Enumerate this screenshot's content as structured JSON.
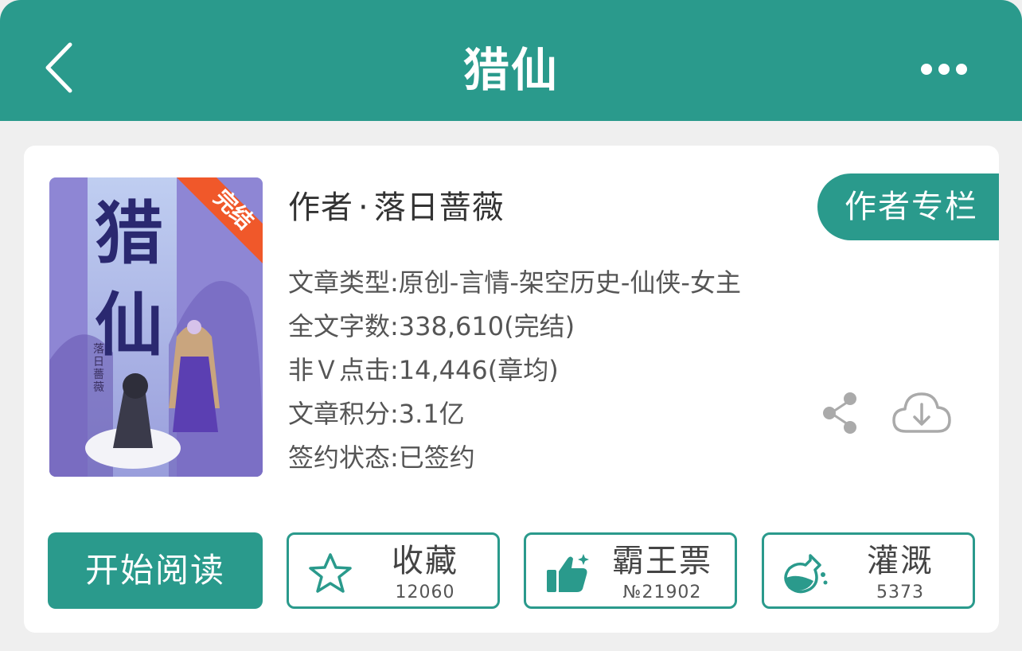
{
  "header": {
    "title": "猎仙"
  },
  "book": {
    "cover_title": "猎仙",
    "cover_badge": "完结",
    "cover_signature": "落日薔薇",
    "author_prefix": "作者",
    "author_sep": "·",
    "author_name": "落日蔷薇",
    "author_column_label": "作者专栏"
  },
  "info": {
    "genre": "文章类型:原创-言情-架空历史-仙侠-女主",
    "word_count": "全文字数:338,610(完结)",
    "clicks": "非Ｖ点击:14,446(章均)",
    "score": "文章积分:3.1亿",
    "contract": "签约状态:已签约"
  },
  "actions": {
    "read_label": "开始阅读",
    "favorite": {
      "label": "收藏",
      "count": "12060"
    },
    "tyrant_ticket": {
      "label": "霸王票",
      "count": "№21902"
    },
    "nourish": {
      "label": "灌溉",
      "count": "5373"
    }
  },
  "colors": {
    "primary": "#2a9a8c",
    "badge": "#f0582a"
  },
  "icons": {
    "back": "chevron-left-icon",
    "more": "more-dots-icon",
    "share": "share-icon",
    "download": "cloud-download-icon",
    "favorite": "star-icon",
    "ticket": "thumbs-up-icon",
    "nourish": "flask-icon"
  }
}
